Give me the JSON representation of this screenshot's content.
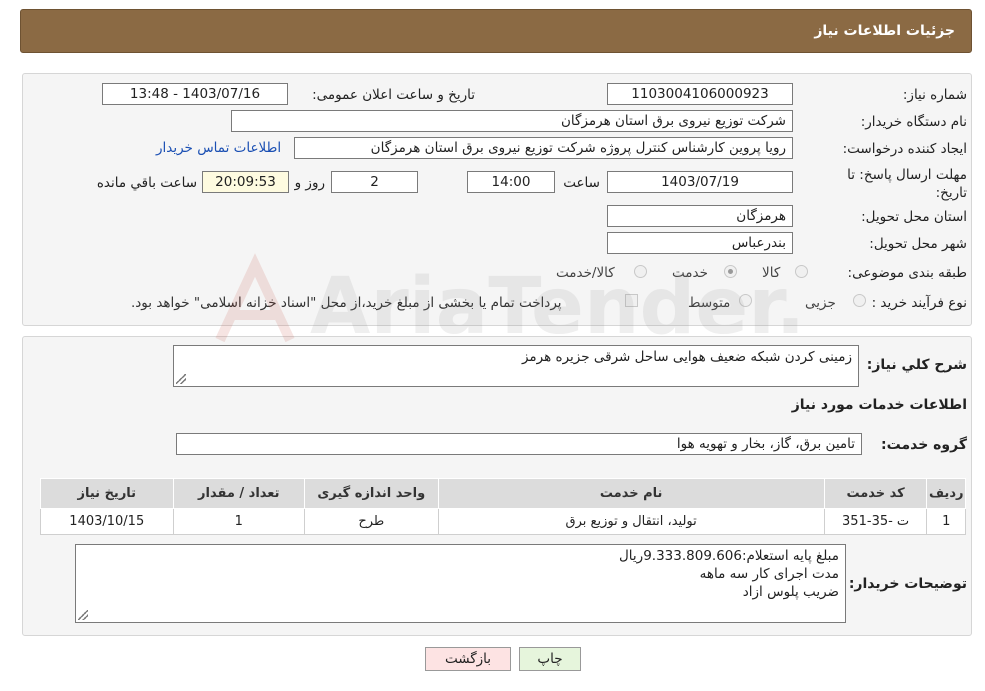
{
  "header": {
    "title": "جزئیات اطلاعات نیاز"
  },
  "fields": {
    "need_number_label": "شماره نیاز:",
    "need_number": "1103004106000923",
    "announce_label": "تاریخ و ساعت اعلان عمومی:",
    "announce_value": "1403/07/16 - 13:48",
    "buyer_org_label": "نام دستگاه خریدار:",
    "buyer_org": "شرکت توزیع نیروی برق استان هرمزگان",
    "requester_label": "ایجاد کننده درخواست:",
    "requester": "رویا پروین کارشناس کنترل پروژه شرکت توزیع نیروی برق استان هرمزگان",
    "buyer_contact_link": "اطلاعات تماس خریدار",
    "deadline_label_1": "مهلت ارسال پاسخ: تا",
    "deadline_label_2": "تاریخ:",
    "deadline_date": "1403/07/19",
    "time_label": "ساعت",
    "deadline_time": "14:00",
    "days_value": "2",
    "days_label": "روز و",
    "remaining_time": "20:09:53",
    "remaining_label": "ساعت باقي مانده",
    "province_label": "استان محل تحویل:",
    "province": "هرمزگان",
    "city_label": "شهر محل تحویل:",
    "city": "بندرعباس",
    "category_label": "طبقه بندی موضوعی:",
    "category_options": [
      "کالا",
      "خدمت",
      "کالا/خدمت"
    ],
    "process_label": "نوع فرآیند خرید :",
    "process_options": [
      "جزیی",
      "متوسط"
    ],
    "payment_note": "پرداخت تمام یا بخشی از مبلغ خرید،از محل \"اسناد خزانه اسلامی\" خواهد بود."
  },
  "summary": {
    "label": "شرح كلي نياز:",
    "value": "زمینی کردن شبکه ضعیف هوایی ساحل شرقی جزیره هرمز"
  },
  "services": {
    "section_title": "اطلاعات خدمات مورد نياز",
    "group_label": "گروه خدمت:",
    "group_value": "تامین برق، گاز، بخار و تهویه هوا",
    "columns": [
      "رديف",
      "کد خدمت",
      "نام خدمت",
      "واحد اندازه گيری",
      "تعداد / مقدار",
      "تاريخ نياز"
    ],
    "rows": [
      [
        "1",
        "ت -35-351",
        "تولید، انتقال و توزیع برق",
        "طرح",
        "1",
        "1403/10/15"
      ]
    ]
  },
  "buyer_notes": {
    "label": "توضيحات خريدار:",
    "line1": "مبلغ پایه استعلام:9.333.809.606ریال",
    "line2": "مدت اجرای کار سه ماهه",
    "line3": "ضریب پلوس ازاد"
  },
  "buttons": {
    "print": "چاپ",
    "back": "بازگشت"
  },
  "watermark_text": "AriaTender.neT",
  "colors": {
    "header": "#8b6a44",
    "back_button": "#fde3e3",
    "print_button": "#e6f5dc",
    "link": "#1a4fb3"
  }
}
